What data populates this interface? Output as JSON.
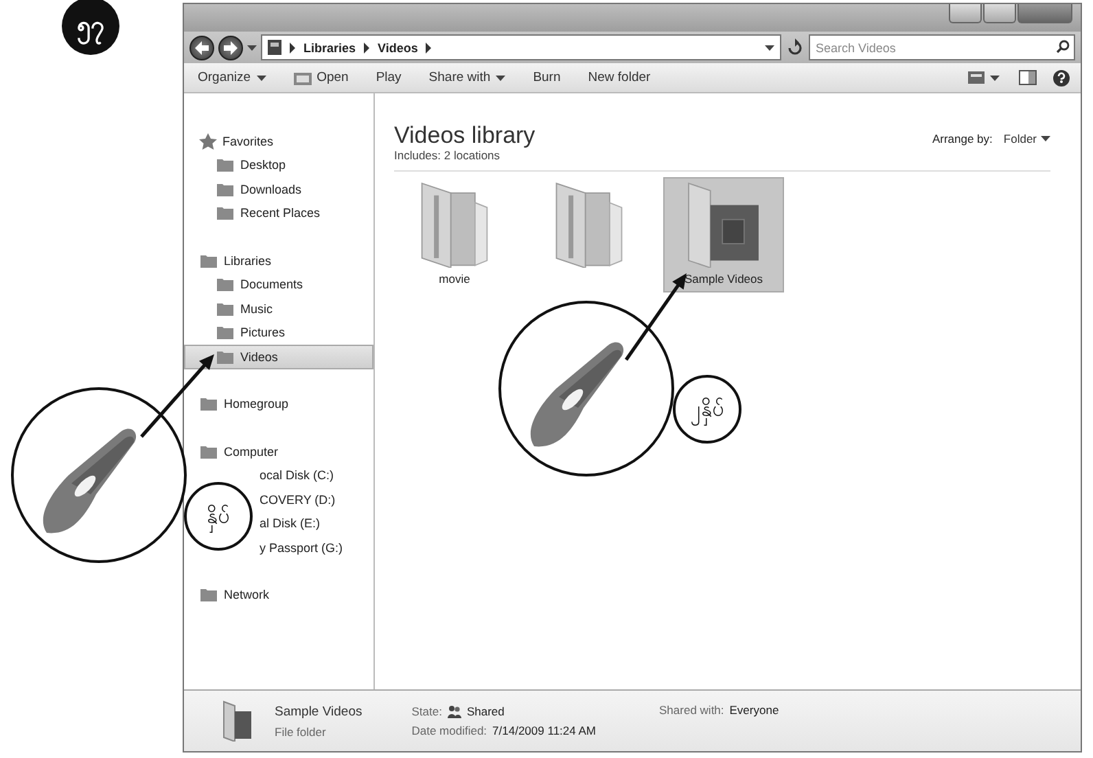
{
  "page_badge": "၅၇",
  "address": {
    "crumbs": [
      "Libraries",
      "Videos"
    ],
    "search_placeholder": "Search Videos"
  },
  "toolbar": [
    {
      "label": "Organize",
      "kind": "menu"
    },
    {
      "label": "Open",
      "kind": "icon"
    },
    {
      "label": "Play",
      "kind": "plain"
    },
    {
      "label": "Share with",
      "kind": "menu"
    },
    {
      "label": "Burn",
      "kind": "plain"
    },
    {
      "label": "New folder",
      "kind": "plain"
    }
  ],
  "nav": [
    {
      "label": "Favorites",
      "selected": false,
      "children": [
        {
          "label": "Desktop",
          "selected": false
        },
        {
          "label": "Downloads",
          "selected": false
        },
        {
          "label": "Recent Places",
          "selected": false
        }
      ]
    },
    {
      "label": "Libraries",
      "selected": false,
      "children": [
        {
          "label": "Documents",
          "selected": false
        },
        {
          "label": "Music",
          "selected": false
        },
        {
          "label": "Pictures",
          "selected": false
        },
        {
          "label": "Videos",
          "selected": true
        }
      ]
    },
    {
      "label": "Homegroup",
      "selected": false
    },
    {
      "label": "Computer",
      "selected": false,
      "children": [
        {
          "label": "ocal Disk (C:)",
          "selected": false
        },
        {
          "label": "COVERY (D:)",
          "selected": false
        },
        {
          "label": "al Disk (E:)",
          "selected": false
        },
        {
          "label": "y Passport (G:)",
          "selected": false
        }
      ]
    },
    {
      "label": "Network",
      "selected": false
    }
  ],
  "library": {
    "title": "Videos library",
    "subtitle": "Includes: 2 locations",
    "arrange_label": "Arrange by:",
    "arrange_value": "Folder"
  },
  "items": [
    {
      "label": "movie",
      "kind": "folder",
      "selected": false
    },
    {
      "kind": "folder",
      "selected": false
    },
    {
      "label": "Sample Videos",
      "kind": "video-folder",
      "selected": true
    }
  ],
  "details": {
    "name": "Sample Videos",
    "type": "File folder",
    "fields": [
      {
        "label": "State:",
        "value": "Shared",
        "kind": "shared"
      },
      {
        "label": "Date modified:",
        "value": "7/14/2009 11:24 AM",
        "kind": "plain"
      },
      {
        "label": "Shared with:",
        "value": "Everyone",
        "kind": "plain"
      }
    ]
  },
  "callouts": [
    {
      "label": "နှိပ်"
    },
    {
      "label": "၂နှိပ်"
    }
  ]
}
